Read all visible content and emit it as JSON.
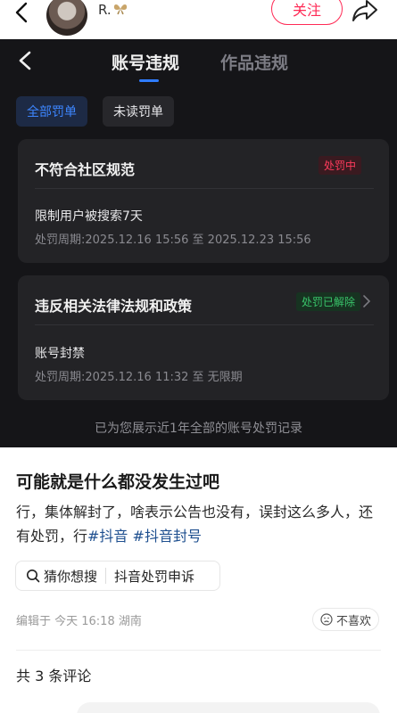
{
  "header": {
    "username": "R.",
    "follow_label": "关注"
  },
  "violation_panel": {
    "tabs": [
      {
        "label": "账号违规",
        "active": true
      },
      {
        "label": "作品违规",
        "active": false
      }
    ],
    "filters": [
      {
        "label": "全部罚单",
        "selected": true
      },
      {
        "label": "未读罚单",
        "selected": false
      }
    ],
    "records": [
      {
        "title": "不符合社区规范",
        "status": "处罚中",
        "status_color": "#ff3b5c",
        "penalty": "限制用户被搜索7天",
        "period": "处罚周期:2025.12.16 15:56 至 2025.12.23 15:56"
      },
      {
        "title": "违反相关法律法规和政策",
        "status": "处罚已解除",
        "status_color": "#39c46a",
        "penalty": "账号封禁",
        "period": "处罚周期:2025.12.16 11:32 至 无限期"
      }
    ],
    "footer_note": "已为您展示近1年全部的账号处罚记录"
  },
  "post": {
    "title": "可能就是什么都没发生过吧",
    "body_text": "行，集体解封了，啥表示公告也没有，误封这么多人，还有处罚，行",
    "hashtags": [
      "#抖音",
      "#抖音封号"
    ],
    "search_label": "猜你想搜",
    "search_term": "抖音处罚申诉",
    "meta": "编辑于 今天 16:18 湖南",
    "dislike_label": "不喜欢",
    "comments_count": "共 3 条评论"
  },
  "colors": {
    "accent_red": "#ff2a55",
    "accent_blue": "#2f7cff",
    "panel_bg": "#151518",
    "card_bg": "#232326"
  }
}
